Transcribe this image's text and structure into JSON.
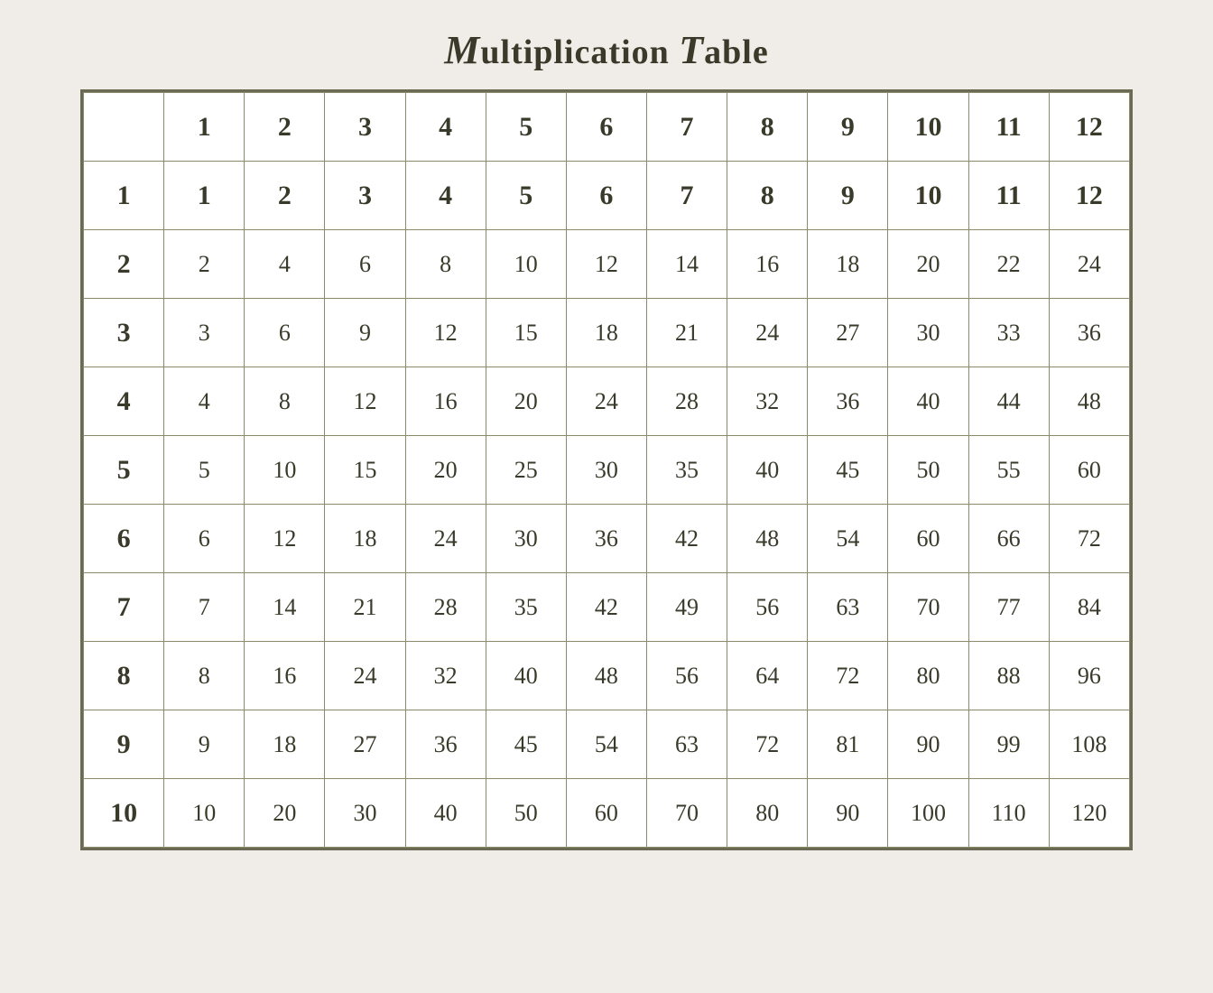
{
  "title": {
    "text": "Multiplication Table",
    "prefix_italic": "M",
    "prefix_T_italic": "T"
  },
  "table": {
    "headers": [
      "",
      "1",
      "2",
      "3",
      "4",
      "5",
      "6",
      "7",
      "8",
      "9",
      "10",
      "11",
      "12"
    ],
    "rows": [
      {
        "label": "1",
        "values": [
          1,
          2,
          3,
          4,
          5,
          6,
          7,
          8,
          9,
          10,
          11,
          12
        ]
      },
      {
        "label": "2",
        "values": [
          2,
          4,
          6,
          8,
          10,
          12,
          14,
          16,
          18,
          20,
          22,
          24
        ]
      },
      {
        "label": "3",
        "values": [
          3,
          6,
          9,
          12,
          15,
          18,
          21,
          24,
          27,
          30,
          33,
          36
        ]
      },
      {
        "label": "4",
        "values": [
          4,
          8,
          12,
          16,
          20,
          24,
          28,
          32,
          36,
          40,
          44,
          48
        ]
      },
      {
        "label": "5",
        "values": [
          5,
          10,
          15,
          20,
          25,
          30,
          35,
          40,
          45,
          50,
          55,
          60
        ]
      },
      {
        "label": "6",
        "values": [
          6,
          12,
          18,
          24,
          30,
          36,
          42,
          48,
          54,
          60,
          66,
          72
        ]
      },
      {
        "label": "7",
        "values": [
          7,
          14,
          21,
          28,
          35,
          42,
          49,
          56,
          63,
          70,
          77,
          84
        ]
      },
      {
        "label": "8",
        "values": [
          8,
          16,
          24,
          32,
          40,
          48,
          56,
          64,
          72,
          80,
          88,
          96
        ]
      },
      {
        "label": "9",
        "values": [
          9,
          18,
          27,
          36,
          45,
          54,
          63,
          72,
          81,
          90,
          99,
          108
        ]
      },
      {
        "label": "10",
        "values": [
          10,
          20,
          30,
          40,
          50,
          60,
          70,
          80,
          90,
          100,
          110,
          120
        ]
      }
    ]
  }
}
